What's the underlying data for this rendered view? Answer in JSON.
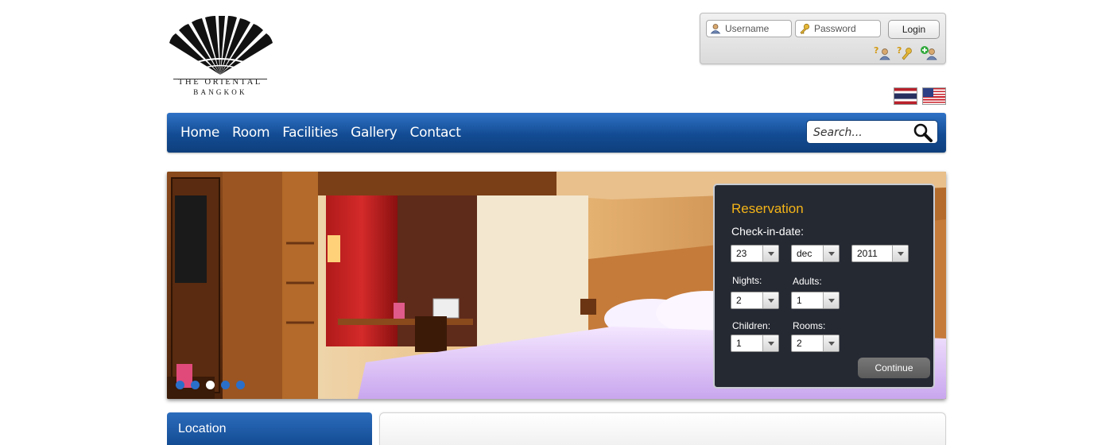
{
  "brand": {
    "name_line1": "THE ORIENTAL",
    "name_line2": "BANGKOK"
  },
  "login": {
    "username_placeholder": "Username",
    "password_placeholder": "Password",
    "login_label": "Login",
    "icons": [
      "forgot-username-icon",
      "forgot-password-icon",
      "register-user-icon"
    ]
  },
  "languages": [
    "thai-flag",
    "us-flag"
  ],
  "nav": {
    "items": [
      {
        "label": "Home"
      },
      {
        "label": "Room"
      },
      {
        "label": "Facilities"
      },
      {
        "label": "Gallery"
      },
      {
        "label": "Contact"
      }
    ],
    "search_placeholder": "Search..."
  },
  "slider": {
    "slide_count": 5,
    "active_index": 2
  },
  "reservation": {
    "title": "Reservation",
    "checkin_label": "Check-in-date:",
    "day": "23",
    "month": "dec",
    "year": "2011",
    "nights_label": "Nights:",
    "nights": "2",
    "adults_label": "Adults:",
    "adults": "1",
    "children_label": "Children:",
    "children": "1",
    "rooms_label": "Rooms:",
    "rooms": "2",
    "continue_label": "Continue"
  },
  "sidebar": {
    "location_title": "Location"
  },
  "colors": {
    "nav_blue": "#134c93",
    "reservation_title": "#f4b418",
    "panel_bg": "#252932"
  }
}
